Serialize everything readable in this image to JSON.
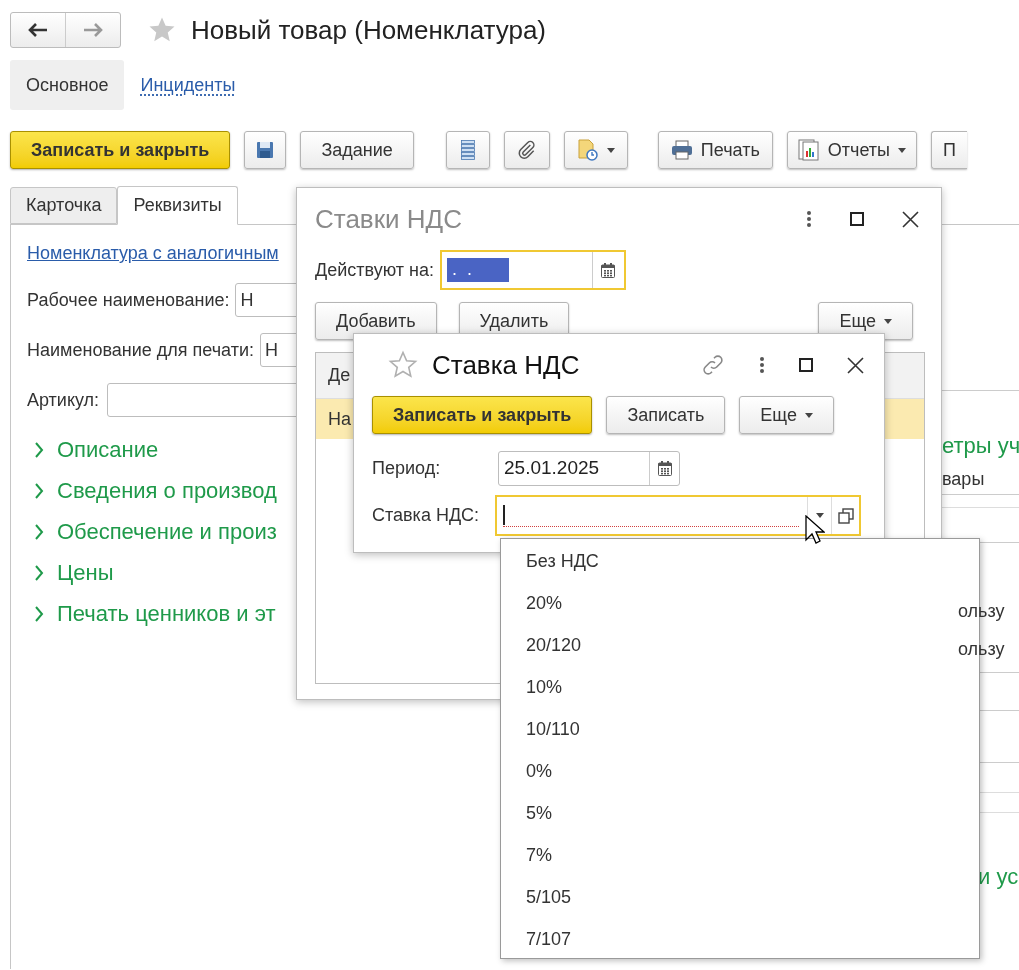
{
  "window": {
    "title": "Новый товар (Номенклатура)",
    "favorite": false
  },
  "nav": [
    {
      "label": "Основное",
      "selected": true
    },
    {
      "label": "Инциденты",
      "selected": false
    }
  ],
  "toolbar": {
    "primary": "Записать и закрыть",
    "task": "Задание",
    "print": "Печать",
    "reports": "Отчеты",
    "cut": "П"
  },
  "tabs": [
    {
      "label": "Карточка",
      "selected": false
    },
    {
      "label": "Реквизиты",
      "selected": true
    }
  ],
  "form": {
    "link": "Номенклатура с аналогичным",
    "fields": [
      {
        "label": "Рабочее наименование:",
        "value": "Н"
      },
      {
        "label": "Наименование для печати:",
        "value": "Н"
      },
      {
        "label": "Артикул:"
      }
    ],
    "sections": [
      {
        "label": "Описание",
        "expanded": false
      },
      {
        "label": "Сведения о производ",
        "expanded": false
      },
      {
        "label": "Обеспечение и произ",
        "expanded": false
      },
      {
        "label": "Цены",
        "expanded": false
      },
      {
        "label": "Печать ценников и эт",
        "expanded": false
      }
    ]
  },
  "right_column": {
    "heading": "етры уч",
    "value": "вары",
    "rows": [
      "ользу",
      "ользу"
    ],
    "heading_2": "и ус"
  },
  "rates_list": {
    "title": "Ставки НДС",
    "date_label": "Действуют на:",
    "date_value": " .  . ",
    "add": "Добавить",
    "delete": "Удалить",
    "more": "Еще",
    "columns": [
      "Де"
    ],
    "rows": [
      {
        "cells": [
          "На"
        ],
        "selected": true
      }
    ]
  },
  "rate_form": {
    "title": "Ставка НДС",
    "favorite": false,
    "primary": "Записать и закрыть",
    "save": "Записать",
    "more": "Еще",
    "period_label": "Период:",
    "period": "25.01.2025",
    "rate_label": "Ставка НДС:"
  },
  "dropdown": {
    "items": [
      {
        "label": "Без НДС",
        "selected": false
      },
      {
        "label": "20%",
        "selected": false
      },
      {
        "label": "20/120",
        "selected": false
      },
      {
        "label": "10%",
        "selected": false
      },
      {
        "label": "10/110",
        "selected": false
      },
      {
        "label": "0%",
        "selected": false
      },
      {
        "label": "5%",
        "selected": false
      },
      {
        "label": "7%",
        "selected": false
      },
      {
        "label": "5/105",
        "selected": false
      },
      {
        "label": "7/107",
        "selected": false
      }
    ]
  }
}
